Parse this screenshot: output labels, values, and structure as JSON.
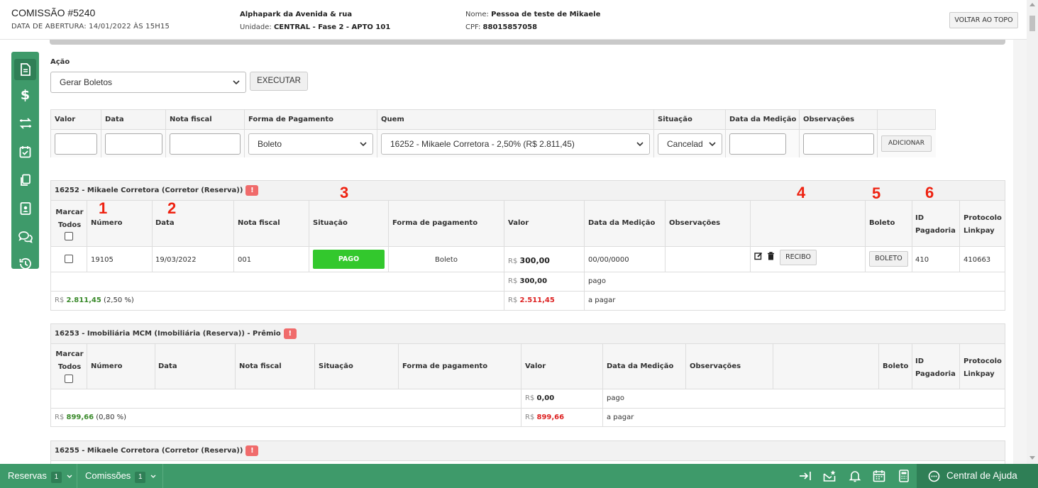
{
  "header": {
    "title": "COMISSÃO #5240",
    "subtitle": "DATA DE ABERTURA: 14/01/2022 ÀS 15H15",
    "empreendimento": "Alphapark da Avenida & rua",
    "unidade_label": "Unidade:",
    "unidade_value": "CENTRAL - Fase 2 - APTO 101",
    "nome_label": "Nome:",
    "nome_value": "Pessoa de teste de Mikaele",
    "cpf_label": "CPF:",
    "cpf_value": "88015857058",
    "back_to_top": "VOLTAR AO TOPO"
  },
  "action": {
    "label": "Ação",
    "selected": "Gerar Boletos",
    "execute": "EXECUTAR"
  },
  "add_form": {
    "columns": [
      "Valor",
      "Data",
      "Nota fiscal",
      "Forma de Pagamento",
      "Quem",
      "Situação",
      "Data da Medição",
      "Observações"
    ],
    "forma_pagamento": "Boleto",
    "quem": "16252 - Mikaele Corretora - 2,50% (R$ 2.811,45)",
    "situacao": "Cancelad",
    "add_button": "ADICIONAR"
  },
  "annotations": [
    "1",
    "2",
    "3",
    "4",
    "5",
    "6"
  ],
  "currency": "R$",
  "groups": [
    {
      "title": "16252 - Mikaele Corretora (Corretor (Reserva))",
      "warn": "!",
      "headers": {
        "marcar": "Marcar",
        "todos": "Todos",
        "numero": "Número",
        "data": "Data",
        "nota": "Nota fiscal",
        "situacao": "Situação",
        "forma": "Forma de pagamento",
        "valor": "Valor",
        "medicao": "Data da Medição",
        "obs": "Observações",
        "boleto": "Boleto",
        "id1": "ID",
        "id2": "Pagadoria",
        "prot1": "Protocolo",
        "prot2": "Linkpay"
      },
      "row": {
        "numero": "19105",
        "data": "19/03/2022",
        "nota": "001",
        "situacao": "PAGO",
        "forma": "Boleto",
        "valor": "300,00",
        "medicao": "00/00/0000",
        "recibo": "RECIBO",
        "boleto": "BOLETO",
        "id": "410",
        "protocolo": "410663"
      },
      "pago_total": "300,00",
      "pago_label": "pago",
      "total": "2.811,45",
      "total_pct": "(2,50 %)",
      "apagar": "2.511,45",
      "apagar_label": "a pagar"
    },
    {
      "title": "16253 - Imobiliária MCM (Imobiliária (Reserva)) - Prêmio",
      "warn": "!",
      "headers": {
        "marcar": "Marcar",
        "todos": "Todos",
        "numero": "Número",
        "data": "Data",
        "nota": "Nota fiscal",
        "situacao": "Situação",
        "forma": "Forma de pagamento",
        "valor": "Valor",
        "medicao": "Data da Medição",
        "obs": "Observações",
        "boleto": "Boleto",
        "id1": "ID",
        "id2": "Pagadoria",
        "prot1": "Protocolo",
        "prot2": "Linkpay"
      },
      "pago_total": "0,00",
      "pago_label": "pago",
      "total": "899,66",
      "total_pct": "(0,80 %)",
      "apagar": "899,66",
      "apagar_label": "a pagar"
    },
    {
      "title": "16255 - Mikaele Corretora (Corretor (Reserva))",
      "warn": "!"
    }
  ],
  "footer": {
    "reservas": "Reservas",
    "reservas_count": "1",
    "comissoes": "Comissões",
    "comissoes_count": "1",
    "help": "Central de Ajuda"
  },
  "colors": {
    "brand_green": "#3e9a6a",
    "paid_badge": "#33c82d",
    "warn": "#f06b6b",
    "annotation": "#e21111"
  }
}
